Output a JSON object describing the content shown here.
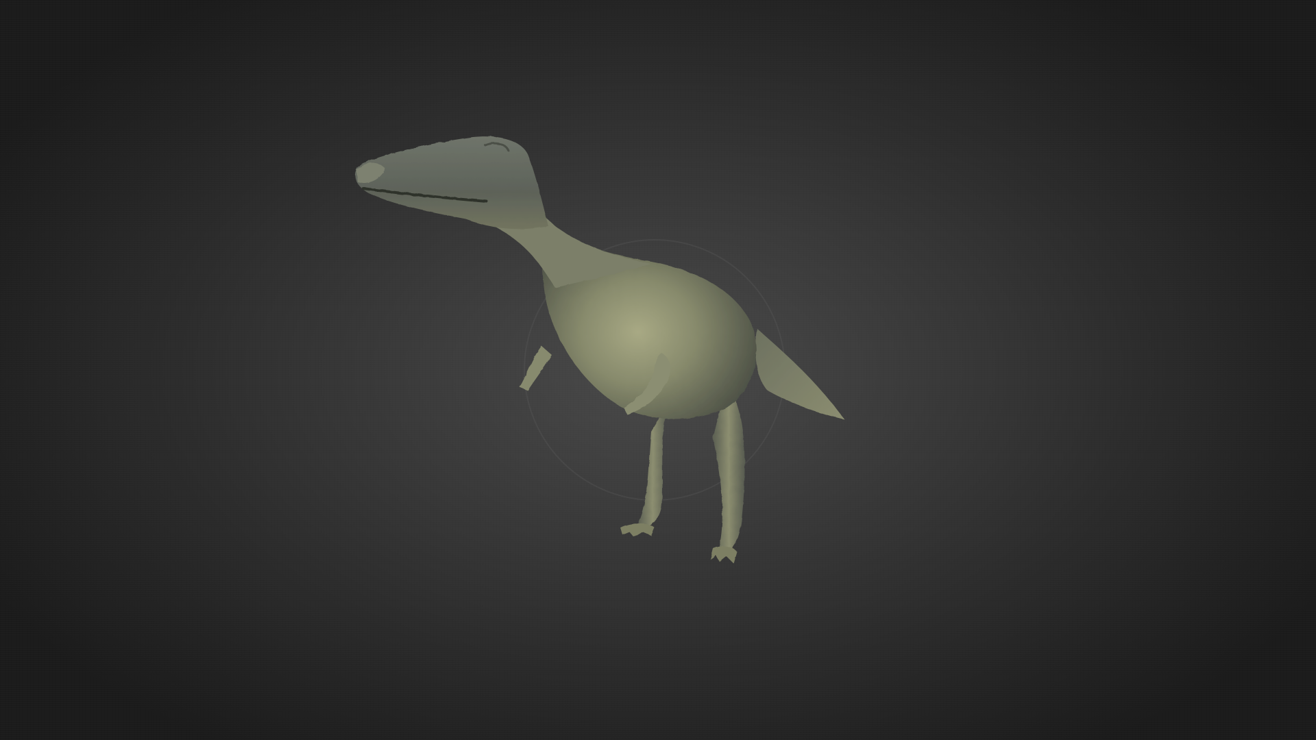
{
  "viewer": {
    "background_center": "#4a4a4a",
    "background_edge": "#1b1b1b"
  },
  "model": {
    "object": "dinosaur-model",
    "surface_color": "#8a8d6e",
    "shadow_color": "#3d4038",
    "highlight_color": "#b7b893"
  }
}
